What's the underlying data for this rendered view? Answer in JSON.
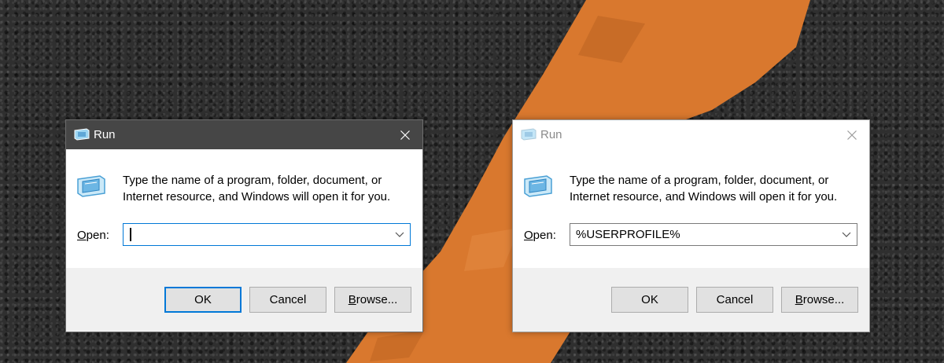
{
  "colors": {
    "active_titlebar": "#464646",
    "inactive_titlebar": "#ffffff",
    "focus_accent": "#0078d7",
    "footer_bg": "#f0f0f0",
    "button_bg": "#e1e1e1",
    "paint_orange": "#d9782e",
    "asphalt": "#2f2f2f"
  },
  "windows": [
    {
      "state": "active",
      "title": "Run",
      "description": "Type the name of a program, folder, document, or Internet resource, and Windows will open it for you.",
      "open_label_mnemonic": "O",
      "open_label_rest": "pen:",
      "open_value": "",
      "buttons": {
        "ok": "OK",
        "cancel": "Cancel",
        "browse_mnemonic": "B",
        "browse_rest": "rowse..."
      }
    },
    {
      "state": "inactive",
      "title": "Run",
      "description": "Type the name of a program, folder, document, or Internet resource, and Windows will open it for you.",
      "open_label_mnemonic": "O",
      "open_label_rest": "pen:",
      "open_value": "%USERPROFILE%",
      "buttons": {
        "ok": "OK",
        "cancel": "Cancel",
        "browse_mnemonic": "B",
        "browse_rest": "rowse..."
      }
    }
  ]
}
